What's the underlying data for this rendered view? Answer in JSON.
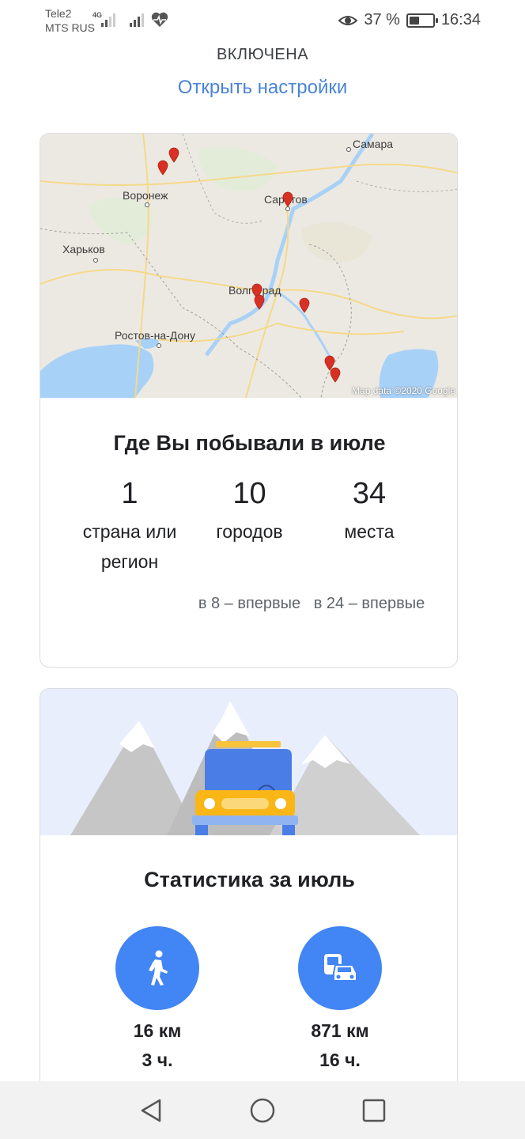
{
  "status_bar": {
    "carrier1": "Tele2",
    "carrier2": "MTS RUS",
    "network_tag": "4G",
    "battery_text": "37 %",
    "time": "16:34",
    "icons": [
      "signal-icon",
      "heart-rate-icon",
      "eye-icon",
      "battery-icon"
    ]
  },
  "header": {
    "status_text": "ВКЛЮЧЕНА",
    "settings_link": "Открыть настройки"
  },
  "map": {
    "labels": [
      "Самара",
      "Воронеж",
      "Саратов",
      "Харьков",
      "Волгоград",
      "Ростов-на-Дону"
    ],
    "attribution": "Map data ©2020 Google",
    "pin_count": 9
  },
  "places_card": {
    "title": "Где Вы побывали в июле",
    "stats": [
      {
        "number": "1",
        "label": "страна или регион",
        "new": ""
      },
      {
        "number": "10",
        "label": "городов",
        "new": "в 8 – впервые"
      },
      {
        "number": "34",
        "label": "места",
        "new": "в 24 – впервые"
      }
    ]
  },
  "stats_card": {
    "title": "Статистика за июль",
    "metrics": [
      {
        "icon": "walking-icon",
        "distance": "16 км",
        "duration": "3 ч."
      },
      {
        "icon": "transit-car-icon",
        "distance": "871 км",
        "duration": "16 ч."
      }
    ]
  },
  "nav": {
    "buttons": [
      "back-button",
      "home-button",
      "recents-button"
    ]
  },
  "colors": {
    "accent": "#4285f4",
    "link": "#4a84d8",
    "pin": "#d93025"
  }
}
